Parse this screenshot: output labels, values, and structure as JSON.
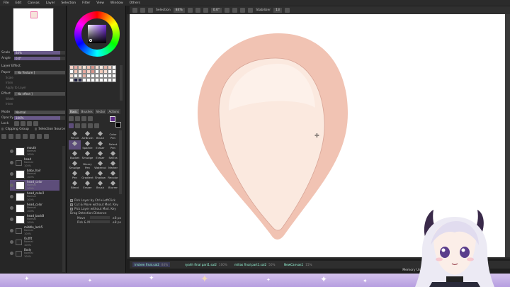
{
  "menu": [
    "File",
    "Edit",
    "Canvas",
    "Layer",
    "Selection",
    "Filter",
    "View",
    "Window",
    "Others"
  ],
  "toolbar": {
    "selection_label": "Selection",
    "zoom_value": "84%",
    "rotation_value": "0.0°",
    "stabilizer_label": "Stabilizer",
    "stabilizer_value": "13"
  },
  "navigator": {
    "scale_label": "Scale",
    "scale_value": "84%",
    "angle_label": "Angle",
    "angle_value": "0.0°"
  },
  "layer_effect": {
    "title": "Layer Effect",
    "paper_label": "Paper",
    "paper_value": "[ No Texture ]",
    "scale_label": "Scale",
    "intensity_label": "Inten",
    "apply_text": "Apply to Layer",
    "effect_label": "Effect",
    "effect_value": "[ No effect ]",
    "width_label": "Width",
    "intensity2_label": "Inten"
  },
  "layer_props": {
    "mode_label": "Mode",
    "mode_value": "Normal",
    "opacity_label": "Opacity",
    "opacity_value": "100%",
    "lock_label": "Lock",
    "clipping_label": "Clipping Group",
    "selection_source_label": "Selection Source"
  },
  "layers": [
    {
      "name": "mouth",
      "mode": "Normal",
      "opacity": "100%",
      "type": "layer"
    },
    {
      "name": "head",
      "mode": "Normal",
      "opacity": "100%",
      "type": "folder"
    },
    {
      "name": "baby_hair",
      "mode": "Normal",
      "opacity": "100%",
      "type": "layer"
    },
    {
      "name": "head_color",
      "mode": "Normal",
      "opacity": "100%",
      "type": "layer",
      "selected": true
    },
    {
      "name": "head_color2",
      "mode": "Normal",
      "opacity": "100%",
      "type": "layer"
    },
    {
      "name": "head_color",
      "mode": "Normal",
      "opacity": "100%",
      "type": "layer"
    },
    {
      "name": "head_backB",
      "mode": "Normal",
      "opacity": "100%",
      "type": "layer"
    },
    {
      "name": "middle_lock5",
      "mode": "Normal",
      "opacity": "100%",
      "type": "folder"
    },
    {
      "name": "Outfit",
      "mode": "Normal",
      "opacity": "100%",
      "type": "folder"
    },
    {
      "name": "Body",
      "mode": "Normal",
      "opacity": "100%",
      "type": "folder"
    }
  ],
  "tool_tabs": [
    "Basic",
    "Brushes",
    "Vector",
    "Actions"
  ],
  "tools": [
    {
      "name": "Pencil"
    },
    {
      "name": "AirBrush"
    },
    {
      "name": "Brush"
    },
    {
      "name": "Color Pen"
    },
    {
      "name": ""
    },
    {
      "name": "Sparkle"
    },
    {
      "name": "Eraser"
    },
    {
      "name": "Select Pen"
    },
    {
      "name": "Bucket"
    },
    {
      "name": "Smudge"
    },
    {
      "name": "Eraser"
    },
    {
      "name": "SelEra"
    },
    {
      "name": "Smudge"
    },
    {
      "name": "Binary Pen"
    },
    {
      "name": "Watercol"
    },
    {
      "name": "Marker"
    },
    {
      "name": "Pen"
    },
    {
      "name": "Gradient"
    },
    {
      "name": "Shadow"
    },
    {
      "name": "Recolor"
    },
    {
      "name": "Blend"
    },
    {
      "name": "Eraser"
    },
    {
      "name": "Brush"
    },
    {
      "name": "Blurrer"
    }
  ],
  "tool_options": {
    "pick_ctrl": "Pick Layer by Ctrl+LeftClick",
    "cut_move": "Cut & Move without Mod. Key",
    "pick_layer": "Pick Layer without Mod. Key",
    "drag_label": "Drag Detection Distance",
    "move_label": "Move",
    "move_value": "±8 px",
    "pick_move_label": "Pick & Move",
    "pick_move_value": "±8 px"
  },
  "file_tabs": [
    {
      "name": "Iristem final.sai2",
      "pct": "84%"
    },
    {
      "name": "ryahh final part1.sai2",
      "pct": "100%"
    },
    {
      "name": "milias final part1.sai2",
      "pct": "50%"
    },
    {
      "name": "NewCanvas1",
      "pct": "15%"
    }
  ],
  "memory_label": "Memory Usage",
  "colors": {
    "face_outer": "#f1c3b3",
    "face_inner": "#fbe9df",
    "accent": "#5d4d7a",
    "foreground": "#5e2c88",
    "banner": "#c8b3ea"
  },
  "palette": [
    "#f7d4c9",
    "#e8a9a0",
    "#f0c9b8",
    "#f7e2d6",
    "#f1c3b3",
    "#d7938a",
    "#f6ddd2",
    "#fbe9df",
    "#e6b3a6",
    "#f6d2c4",
    "#ffffff",
    "#ffffff",
    "#f1c3b3",
    "#fbe9df",
    "#e8a9a0",
    "#f7d4c9",
    "#d7938a",
    "#ffffff",
    "#f0c9b8",
    "#f6ddd2",
    "#ffffff",
    "#ffffff",
    "#f7e2d6",
    "#ffffff",
    "#ffffff",
    "#e6b3a6",
    "#ffffff",
    "#ffffff",
    "#ffffff",
    "#ffffff",
    "#ffffff",
    "#ffffff",
    "#ffffff",
    "#ffffff",
    "#1d1d3f",
    "#2c2c4c",
    "#ffffff",
    "#ffffff",
    "#ffffff",
    "#ffffff",
    "#ffffff",
    "#ffffff",
    "#ffffff",
    "#ffffff"
  ]
}
